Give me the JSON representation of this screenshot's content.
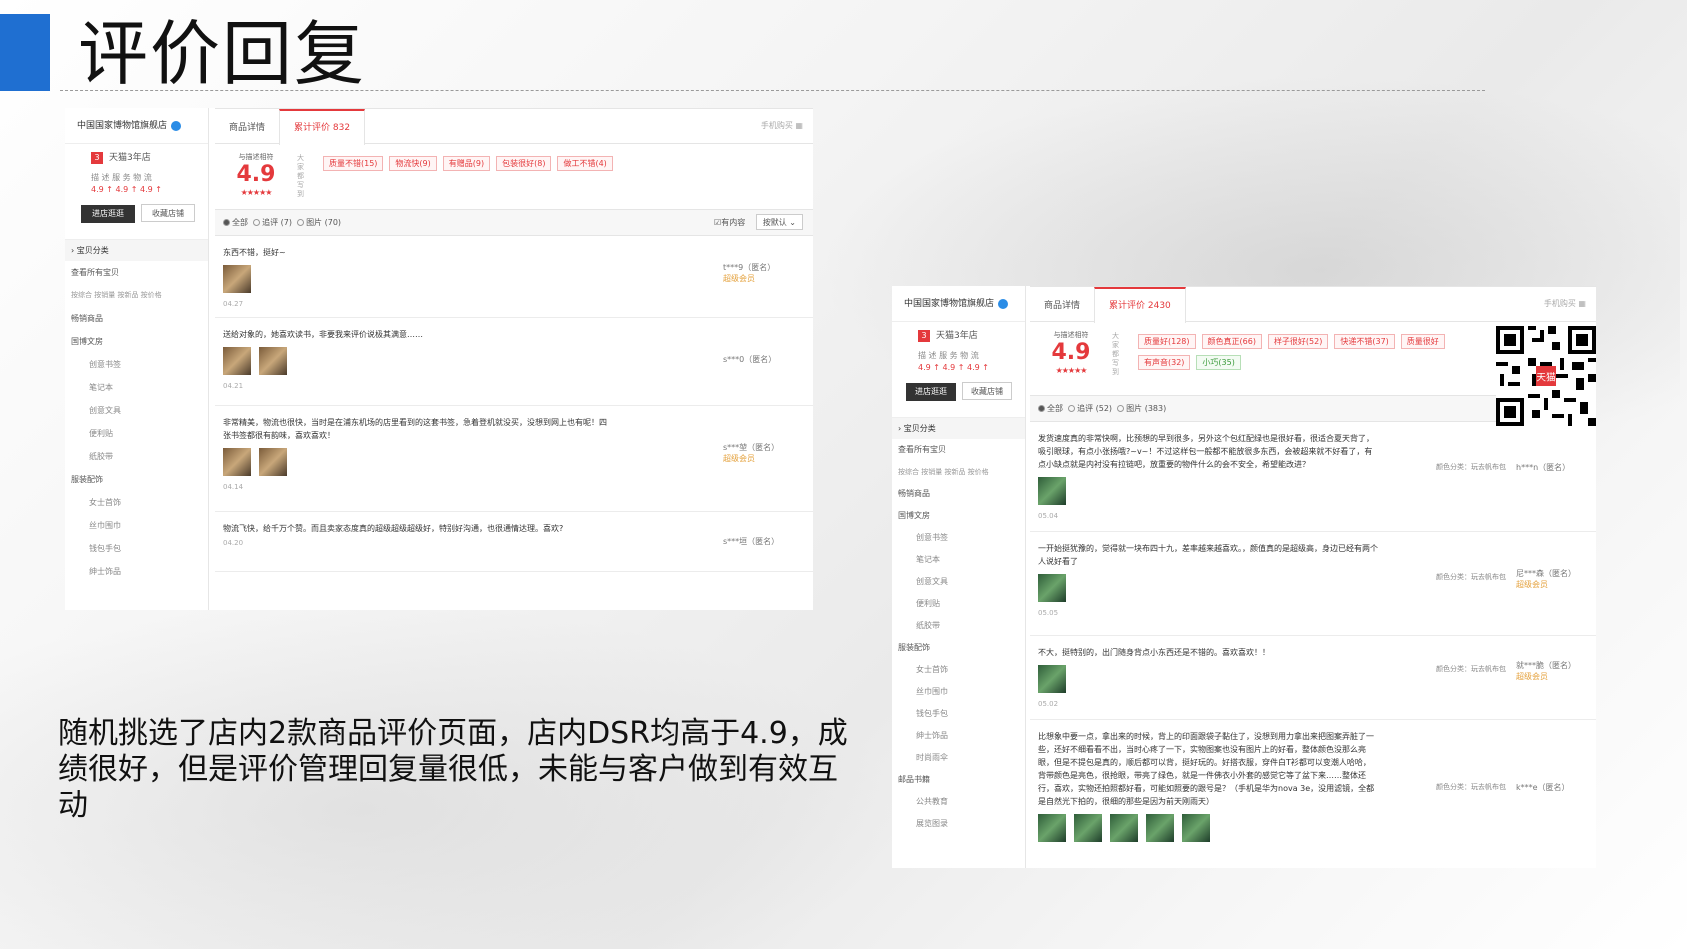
{
  "slide": {
    "title": "评价回复",
    "caption": "随机挑选了店内2款商品评价页面，店内DSR均高于4.9，成绩很好，但是评价管理回复量很低，未能与客户做到有效互动"
  },
  "colors": {
    "accent": "#1f6fd1",
    "brand_red": "#e4393c"
  },
  "shot_a": {
    "store_name": "中国国家博物馆旗舰店",
    "shop_level": "天猫3年店",
    "dsr_labels": "描 述   服 务   物 流",
    "dsr_values": "4.9 ↑   4.9 ↑   4.9 ↑",
    "btn_enter": "进店逛逛",
    "btn_fav": "收藏店铺",
    "nav": {
      "category": "› 宝贝分类",
      "all": "查看所有宝贝",
      "sort": "按综合 按销量 按新品 按价格",
      "hot": "畅销商品",
      "cultural": "国博文房",
      "sub_cultural": [
        "创意书签",
        "笔记本",
        "创意文具",
        "便利贴",
        "纸胶带"
      ],
      "apparel": "服装配饰",
      "sub_apparel": [
        "女士首饰",
        "丝巾围巾",
        "钱包手包",
        "绅士饰品"
      ]
    },
    "tab_detail": "商品详情",
    "tab_reviews": "累计评价 832",
    "buy_phone": "手机购买",
    "score_label": "与描述相符",
    "score": "4.9",
    "stars": "★★★★★",
    "vlabel": "大家都写到",
    "tags": [
      "质量不错(15)",
      "物流快(9)",
      "有赠品(9)",
      "包装很好(8)",
      "做工不错(4)"
    ],
    "filter": {
      "all": "全部",
      "add": "追评 (7)",
      "pic": "图片 (70)",
      "has_content": "有内容",
      "sort": "按默认"
    },
    "reviews": [
      {
        "text": "东西不错，挺好~",
        "date": "04.27",
        "user": "t***9（匿名）",
        "vip": "超级会员",
        "thumbs": 1
      },
      {
        "text": "送给对象的，她喜欢读书，非要我来评价说极其满意……",
        "date": "04.21",
        "user": "s***0（匿名）",
        "vip": "",
        "thumbs": 2
      },
      {
        "text": "非常精美，物流也很快，当时是在浦东机场的店里看到的这套书签，急着登机就没买，没想到网上也有呢！四张书签都很有韵味，喜欢喜欢！",
        "date": "04.14",
        "user": "s***堃（匿名）",
        "vip": "超级会员",
        "thumbs": 2
      },
      {
        "text": "物流飞快，给千万个赞。而且卖家态度真的超级超级超级好，特别好沟通，也很通情达理。喜欢?",
        "date": "04.20",
        "user": "s***垣（匿名）",
        "vip": "",
        "thumbs": 0
      }
    ]
  },
  "shot_b": {
    "store_name": "中国国家博物馆旗舰店",
    "shop_level": "天猫3年店",
    "dsr_labels": "描 述   服 务   物 流",
    "dsr_values": "4.9 ↑   4.9 ↑   4.9 ↑",
    "btn_enter": "进店逛逛",
    "btn_fav": "收藏店铺",
    "nav": {
      "category": "› 宝贝分类",
      "all": "查看所有宝贝",
      "sort": "按综合 按销量 按新品 按价格",
      "hot": "畅销商品",
      "cultural": "国博文房",
      "sub_cultural": [
        "创意书签",
        "笔记本",
        "创意文具",
        "便利贴",
        "纸胶带"
      ],
      "apparel": "服装配饰",
      "sub_apparel": [
        "女士首饰",
        "丝巾围巾",
        "钱包手包",
        "绅士饰品",
        "时尚雨伞"
      ],
      "books": "邮品书籍",
      "sub_books": [
        "公共教育",
        "展览图录"
      ]
    },
    "tab_detail": "商品详情",
    "tab_reviews": "累计评价 2430",
    "buy_phone": "手机购买",
    "score_label": "与描述相符",
    "score": "4.9",
    "stars": "★★★★★",
    "vlabel": "大家都写到",
    "tags": [
      "质量好(128)",
      "颜色真正(66)",
      "样子很好(52)",
      "快递不错(37)",
      "质量很好"
    ],
    "tags_green": [
      "有声音(32)",
      "小巧(35)"
    ],
    "qr_badge": "天猫",
    "filter": {
      "all": "全部",
      "add": "追评 (52)",
      "pic": "图片 (383)"
    },
    "reviews": [
      {
        "text": "发货速度真的非常快啊，比预想的早到很多，另外这个包红配绿也是很好看，很适合夏天背了，吸引眼球，有点小张扬哦?~v~！不过这样包一般都不能放很多东西，会被超来就不好看了，有点小缺点就是内衬没有拉链吧，放重要的物件什么的会不安全，希望能改进？",
        "date": "05.04",
        "spec": "颜色分类：玩去帆布包",
        "user": "h***n（匿名）",
        "vip": "",
        "thumbs": 1
      },
      {
        "text": "一开始挺犹豫的，觉得就一块布四十九，差率越来越喜欢。，颜值真的是超级高，身边已经有两个人说好看了",
        "date": "05.05",
        "spec": "颜色分类：玩去帆布包",
        "user": "尼***森（匿名）",
        "vip": "超级会员",
        "thumbs": 1
      },
      {
        "text": "不大，挺特别的，出门随身背点小东西还是不错的。喜欢喜欢！！",
        "date": "05.02",
        "spec": "颜色分类：玩去帆布包",
        "user": "就***脆（匿名）",
        "vip": "超级会员",
        "thumbs": 1
      },
      {
        "text": "比想象中要一点，拿出来的时候，背上的印面跟袋子黏住了，没想到用力拿出来把图案弄脏了一些，还好不细看看不出，当时心疼了一下，实物图案也没有图片上的好看，整体颜色没那么亮眼，但是不提包是真的，顺后都可以背，挺好玩的。好搭衣服，穿件白T衫都可以变潮人哈哈，背带颜色是亮色，很抢眼，带亮了绿色，就是一件佛衣小外套的感觉它等了盆下来……整体还行，喜欢，实物还拍照都好看，可能如照要的跟号是？（手机是华为nova 3e，没用滤镜，全都是自然光下拍的，很细的那些是因为前天刚雨天）",
        "date": "",
        "spec": "颜色分类：玩去帆布包",
        "user": "k***e（匿名）",
        "vip": "",
        "thumbs": 5
      }
    ]
  }
}
